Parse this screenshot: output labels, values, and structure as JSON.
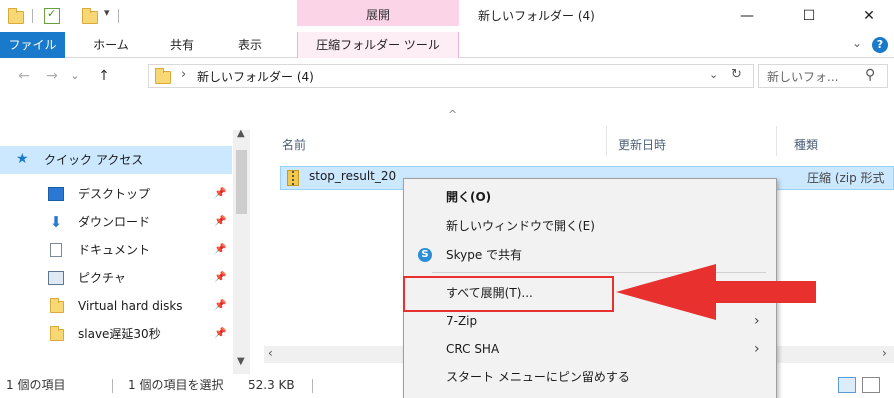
{
  "titlebar": {
    "window_title": "新しいフォルダー (4)",
    "context_tab_header": "展開",
    "qat_dropdown": "▾",
    "minimize": "—",
    "maximize": "☐",
    "close": "✕"
  },
  "ribbon": {
    "tabs": [
      "ファイル",
      "ホーム",
      "共有",
      "表示"
    ],
    "context_tab": "圧縮フォルダー ツール",
    "expand_chevron": "⌄",
    "help": "?"
  },
  "address": {
    "back": "←",
    "forward": "→",
    "recent": "⌄",
    "up": "↑",
    "path": "新しいフォルダー (4)",
    "path_sep": "›",
    "dropdown": "⌄",
    "refresh": "↻",
    "search_placeholder": "新しいフォ...",
    "search_icon": "⚲"
  },
  "navpane": {
    "quick_access": "クイック アクセス",
    "items": [
      {
        "label": "デスクトップ",
        "icon": "desktop-icon"
      },
      {
        "label": "ダウンロード",
        "icon": "download-icon"
      },
      {
        "label": "ドキュメント",
        "icon": "document-icon"
      },
      {
        "label": "ピクチャ",
        "icon": "picture-icon"
      },
      {
        "label": "Virtual hard disks",
        "icon": "folder-icon"
      },
      {
        "label": "slave遅延30秒",
        "icon": "folder-icon"
      }
    ],
    "pin": "📌"
  },
  "content": {
    "columns": [
      "名前",
      "更新日時",
      "種類"
    ],
    "sort_indicator": "^",
    "file": {
      "name": "stop_result_20",
      "type": "圧縮 (zip 形式"
    }
  },
  "statusbar": {
    "item_count": "1 個の項目",
    "selected": "1 個の項目を選択",
    "size": "52.3 KB"
  },
  "context_menu": {
    "items": [
      {
        "label": "開く(O)",
        "bold": true
      },
      {
        "label": "新しいウィンドウで開く(E)"
      },
      {
        "label": "Skype で共有",
        "icon": "skype-icon"
      },
      {
        "label": "すべて展開(T)..."
      },
      {
        "label": "7-Zip",
        "submenu": true
      },
      {
        "label": "CRC SHA",
        "submenu": true
      },
      {
        "label": "スタート メニューにピン留めする"
      }
    ],
    "submenu_arrow": "›"
  },
  "colors": {
    "accent": "#1979ca",
    "selection": "#cce8ff",
    "context_tab": "#fbd4e8",
    "highlight_red": "#e8302e"
  }
}
